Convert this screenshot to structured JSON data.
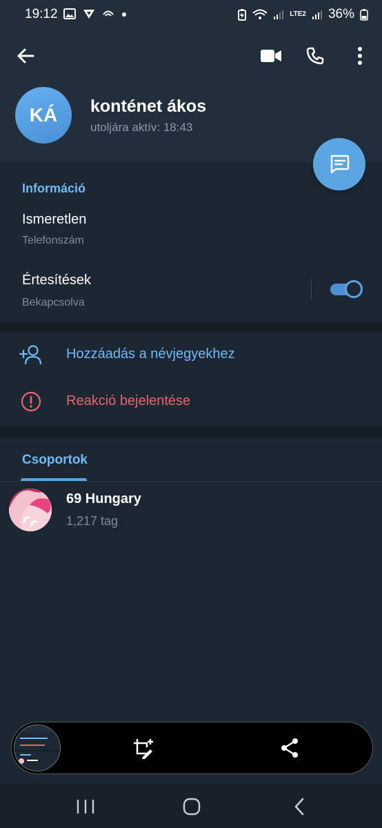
{
  "status_bar": {
    "time": "19:12",
    "battery": "36%",
    "network_label": "LTE2"
  },
  "header": {
    "avatar_initials": "KÁ",
    "name": "konténet ákos",
    "last_seen": "utoljára aktív: 18:43"
  },
  "info": {
    "section_title": "Információ",
    "phone_value": "Ismeretlen",
    "phone_label": "Telefonszám",
    "notifications_title": "Értesítések",
    "notifications_status": "Bekapcsolva",
    "notifications_enabled": true
  },
  "actions": {
    "add_contact_label": "Hozzáadás a névjegyekhez",
    "report_label": "Reakció bejelentése"
  },
  "tabs": {
    "groups_label": "Csoportok"
  },
  "groups": [
    {
      "name": "69 Hungary",
      "members": "1,217 tag"
    }
  ],
  "colors": {
    "accent": "#5aa5e2",
    "link_blue": "#71baf5",
    "danger": "#e5666b",
    "background": "#1d2733",
    "header_bg": "#232e3c"
  },
  "icons": {
    "back": "arrow-left-icon",
    "video": "video-camera-icon",
    "call": "phone-icon",
    "more": "more-vertical-icon",
    "message": "message-icon",
    "add_contact": "add-person-icon",
    "report": "alert-circle-icon",
    "crop": "crop-edit-icon",
    "share": "share-icon"
  }
}
